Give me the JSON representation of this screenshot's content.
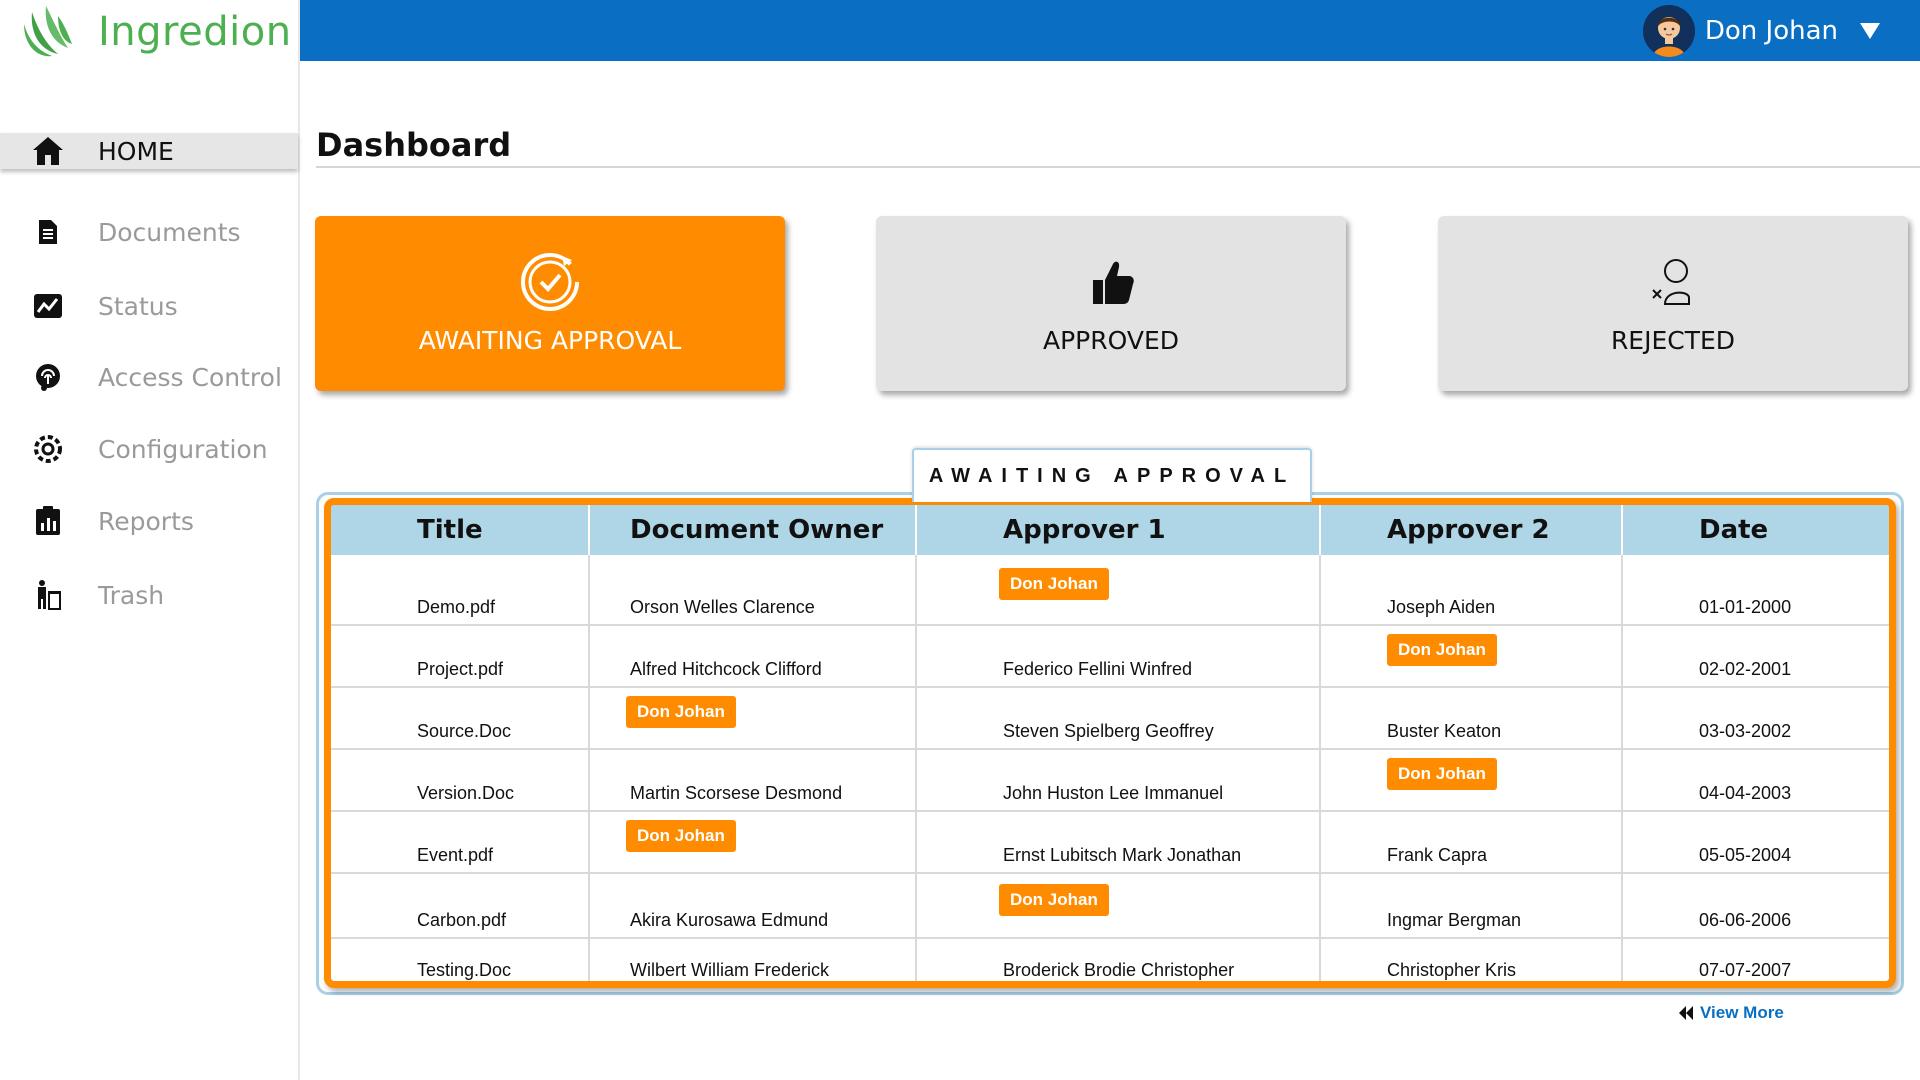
{
  "app": {
    "brand": "Ingredion",
    "user_name": "Don Johan",
    "colors": {
      "topbar": "#0a6fc3",
      "accent": "#ff8c00",
      "header_row": "#aed6e6",
      "brand_green": "#4caf50"
    }
  },
  "sidebar": {
    "items": [
      {
        "label": "HOME",
        "icon": "home-icon",
        "active": true
      },
      {
        "label": "Documents",
        "icon": "document-icon"
      },
      {
        "label": "Status",
        "icon": "status-chart-icon"
      },
      {
        "label": "Access Control",
        "icon": "fingerprint-icon"
      },
      {
        "label": "Configuration",
        "icon": "gear-icon"
      },
      {
        "label": "Reports",
        "icon": "clipboard-chart-icon"
      },
      {
        "label": "Trash",
        "icon": "trash-person-icon"
      }
    ]
  },
  "page": {
    "title": "Dashboard"
  },
  "cards": {
    "awaiting": {
      "label": "AWAITING APPROVAL",
      "icon": "refresh-check-icon"
    },
    "approved": {
      "label": "APPROVED",
      "icon": "thumbs-up-icon"
    },
    "rejected": {
      "label": "REJECTED",
      "icon": "user-x-icon"
    }
  },
  "table": {
    "tab_label": "AWAITING APPROVAL",
    "columns": [
      "Title",
      "Document Owner",
      "Approver 1",
      "Approver 2",
      "Date"
    ],
    "rows": [
      [
        "Demo.pdf",
        "Orson Welles Clarence",
        "Don Johan",
        "Joseph Aiden",
        "01-01-2000"
      ],
      [
        "Project.pdf",
        "Alfred Hitchcock Clifford",
        "Federico Fellini Winfred",
        "Don Johan",
        "02-02-2001"
      ],
      [
        "Source.Doc",
        "Don Johan",
        "Steven Spielberg Geoffrey",
        "Buster Keaton",
        "03-03-2002"
      ],
      [
        "Version.Doc",
        "Martin Scorsese Desmond",
        "John Huston Lee Immanuel",
        "Don Johan",
        "04-04-2003"
      ],
      [
        "Event.pdf",
        "Don Johan",
        "Ernst Lubitsch Mark Jonathan",
        "Frank Capra",
        "05-05-2004"
      ],
      [
        "Carbon.pdf",
        "Akira Kurosawa Edmund",
        "Don Johan",
        "Ingmar Bergman",
        "06-06-2006"
      ],
      [
        "Testing.Doc",
        "Wilbert William Frederick",
        "Broderick Brodie Christopher",
        "Christopher Kris",
        "07-07-2007"
      ]
    ],
    "view_more": "View More"
  }
}
